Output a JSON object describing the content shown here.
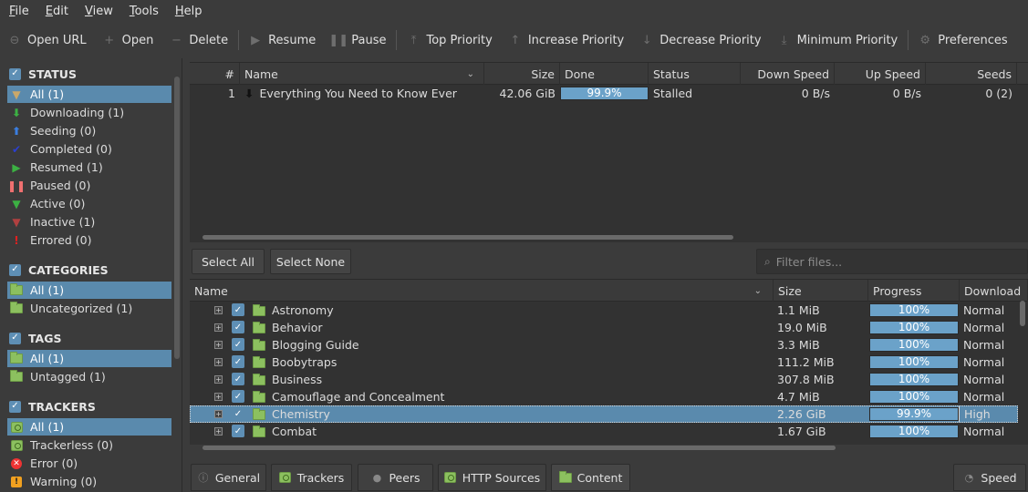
{
  "menu": [
    "File",
    "Edit",
    "View",
    "Tools",
    "Help"
  ],
  "toolbar": [
    {
      "label": "Open URL",
      "icon": "link-icon"
    },
    {
      "label": "Open",
      "icon": "plus-icon"
    },
    {
      "label": "Delete",
      "icon": "minus-icon"
    },
    {
      "label": "Resume",
      "icon": "play-icon"
    },
    {
      "label": "Pause",
      "icon": "pause-icon"
    },
    {
      "label": "Top Priority",
      "icon": "top-priority-icon"
    },
    {
      "label": "Increase Priority",
      "icon": "arrow-up-icon"
    },
    {
      "label": "Decrease Priority",
      "icon": "arrow-down-icon"
    },
    {
      "label": "Minimum Priority",
      "icon": "min-priority-icon"
    },
    {
      "label": "Preferences",
      "icon": "gear-icon"
    }
  ],
  "sidebar": {
    "status": {
      "title": "STATUS",
      "items": [
        {
          "label": "All (1)",
          "icon": "filter-icon",
          "color": "#c9a86a"
        },
        {
          "label": "Downloading (1)",
          "icon": "download-arrow-icon",
          "color": "#3cb043"
        },
        {
          "label": "Seeding (0)",
          "icon": "upload-arrow-icon",
          "color": "#3b7ee0"
        },
        {
          "label": "Completed (0)",
          "icon": "checkmark-icon",
          "color": "#2b3fd0"
        },
        {
          "label": "Resumed (1)",
          "icon": "play-icon",
          "color": "#3cb043"
        },
        {
          "label": "Paused (0)",
          "icon": "pause-icon",
          "color": "#f07070"
        },
        {
          "label": "Active (0)",
          "icon": "filter-icon",
          "color": "#3cb043"
        },
        {
          "label": "Inactive (1)",
          "icon": "filter-icon",
          "color": "#b04040"
        },
        {
          "label": "Errored (0)",
          "icon": "exclamation-icon",
          "color": "#e02020"
        }
      ]
    },
    "categories": {
      "title": "CATEGORIES",
      "items": [
        {
          "label": "All (1)"
        },
        {
          "label": "Uncategorized (1)"
        }
      ]
    },
    "tags": {
      "title": "TAGS",
      "items": [
        {
          "label": "All (1)"
        },
        {
          "label": "Untagged (1)"
        }
      ]
    },
    "trackers": {
      "title": "TRACKERS",
      "items": [
        {
          "label": "All (1)",
          "icon": "tracker-icon"
        },
        {
          "label": "Trackerless (0)",
          "icon": "tracker-icon"
        },
        {
          "label": "Error (0)",
          "icon": "error-icon"
        },
        {
          "label": "Warning (0)",
          "icon": "warning-icon"
        }
      ]
    }
  },
  "torrent_list": {
    "columns": [
      "#",
      "Name",
      "Size",
      "Done",
      "Status",
      "Down Speed",
      "Up Speed",
      "Seeds"
    ],
    "rows": [
      {
        "num": "1",
        "name": "Everything You Need to Know Ever",
        "size": "42.06 GiB",
        "done": "99.9%",
        "done_fraction": 0.999,
        "status": "Stalled",
        "down_speed": "0 B/s",
        "up_speed": "0 B/s",
        "seeds": "0 (2)"
      }
    ]
  },
  "content": {
    "select_all": "Select All",
    "select_none": "Select None",
    "filter_placeholder": "Filter files...",
    "columns": [
      "Name",
      "Size",
      "Progress",
      "Download"
    ],
    "rows": [
      {
        "name": "Astronomy",
        "size": "1.1 MiB",
        "progress": "100%",
        "progress_fraction": 1.0,
        "priority": "Normal"
      },
      {
        "name": "Behavior",
        "size": "19.0 MiB",
        "progress": "100%",
        "progress_fraction": 1.0,
        "priority": "Normal"
      },
      {
        "name": "Blogging Guide",
        "size": "3.3 MiB",
        "progress": "100%",
        "progress_fraction": 1.0,
        "priority": "Normal"
      },
      {
        "name": "Boobytraps",
        "size": "111.2 MiB",
        "progress": "100%",
        "progress_fraction": 1.0,
        "priority": "Normal"
      },
      {
        "name": "Business",
        "size": "307.8 MiB",
        "progress": "100%",
        "progress_fraction": 1.0,
        "priority": "Normal"
      },
      {
        "name": "Camouflage and Concealment",
        "size": "4.7 MiB",
        "progress": "100%",
        "progress_fraction": 1.0,
        "priority": "Normal"
      },
      {
        "name": "Chemistry",
        "size": "2.26 GiB",
        "progress": "99.9%",
        "progress_fraction": 0.999,
        "priority": "High",
        "selected": true
      },
      {
        "name": "Combat",
        "size": "1.67 GiB",
        "progress": "100%",
        "progress_fraction": 1.0,
        "priority": "Normal"
      }
    ]
  },
  "bottom_tabs": [
    {
      "label": "General",
      "icon": "info-icon"
    },
    {
      "label": "Trackers",
      "icon": "tracker-icon"
    },
    {
      "label": "Peers",
      "icon": "peers-icon"
    },
    {
      "label": "HTTP Sources",
      "icon": "tracker-icon"
    },
    {
      "label": "Content",
      "icon": "folder-icon",
      "active": true
    }
  ],
  "speed_button": "Speed",
  "colors": {
    "accent": "#5a8aad",
    "progress": "#6ba2c9",
    "folder": "#8cc05f"
  }
}
